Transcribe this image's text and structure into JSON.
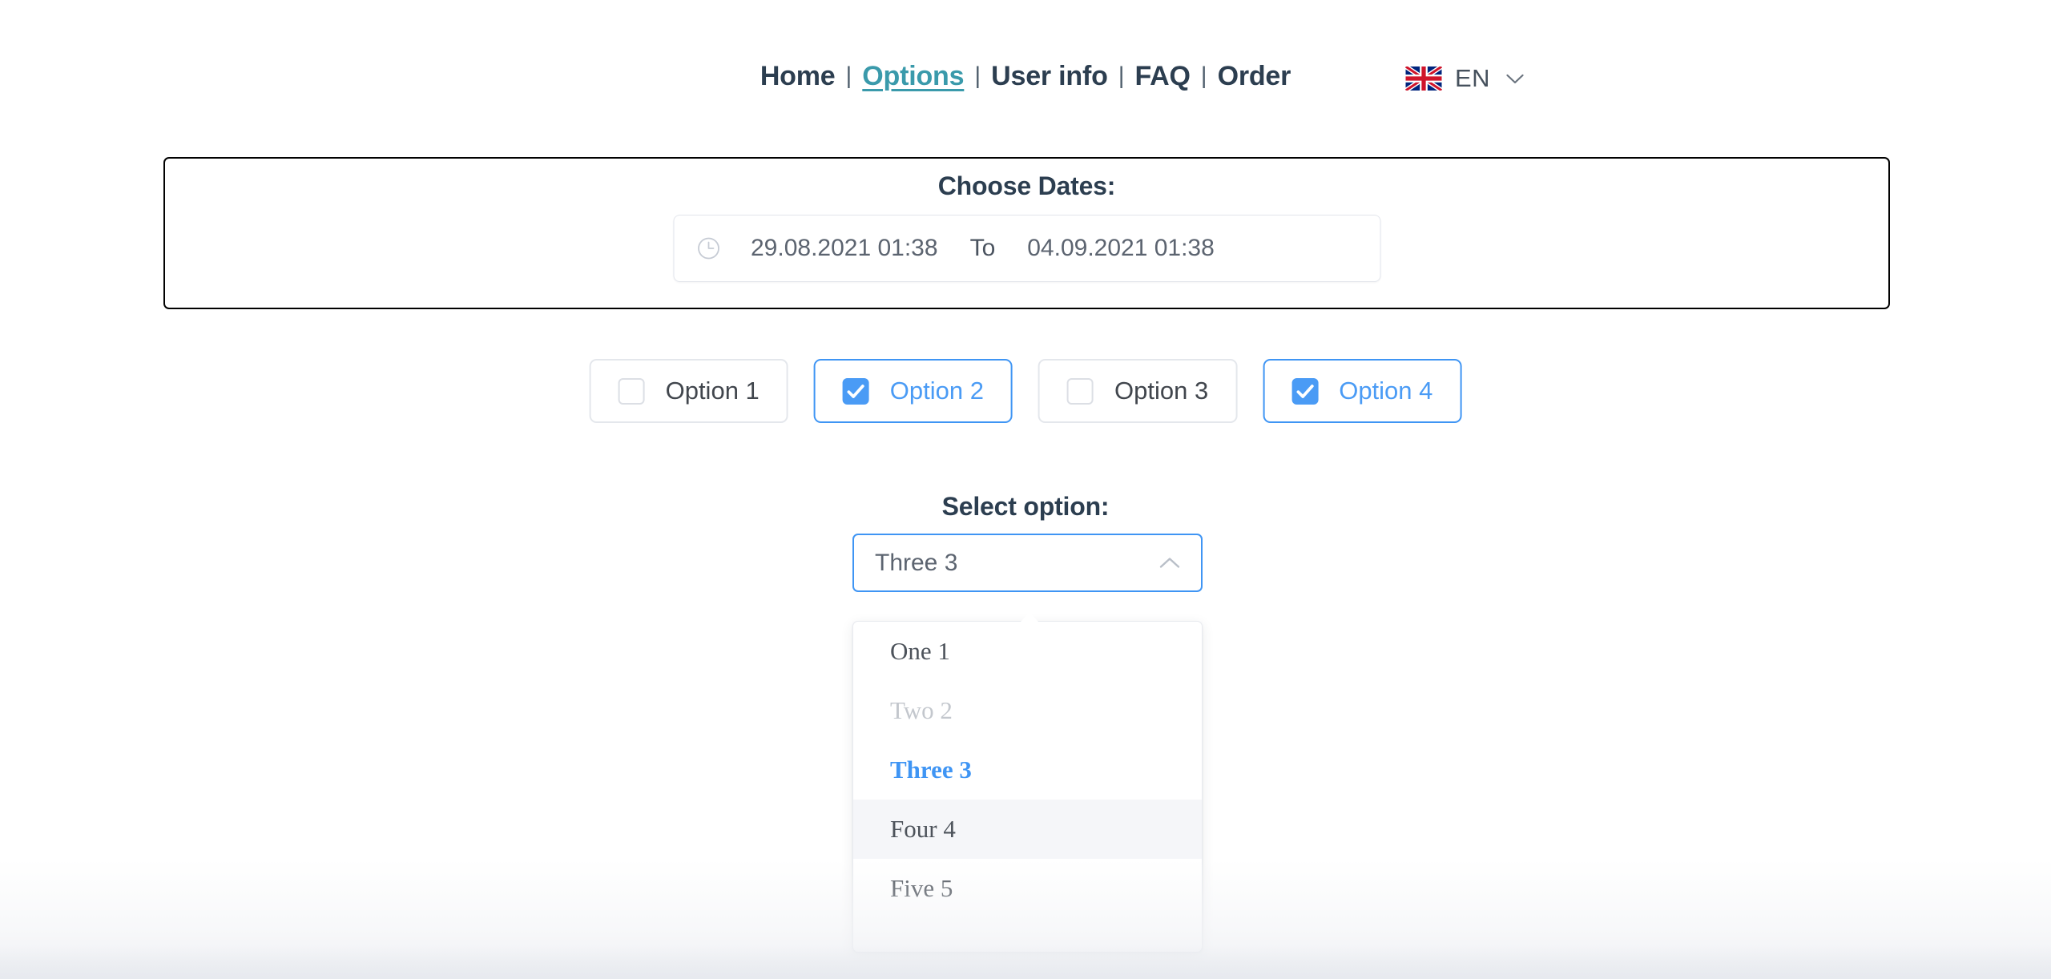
{
  "nav": {
    "separator": "|",
    "items": [
      {
        "label": "Home",
        "active": false
      },
      {
        "label": "Options",
        "active": true
      },
      {
        "label": "User info",
        "active": false
      },
      {
        "label": "FAQ",
        "active": false
      },
      {
        "label": "Order",
        "active": false
      }
    ]
  },
  "language": {
    "code": "EN",
    "flag": "uk-flag-icon",
    "chevron": "chevron-down-icon"
  },
  "dates": {
    "title": "Choose Dates:",
    "icon": "clock-icon",
    "from": "29.08.2021 01:38",
    "separator": "To",
    "to": "04.09.2021 01:38"
  },
  "options": {
    "items": [
      {
        "label": "Option 1",
        "checked": false
      },
      {
        "label": "Option 2",
        "checked": true
      },
      {
        "label": "Option 3",
        "checked": false
      },
      {
        "label": "Option 4",
        "checked": true
      }
    ]
  },
  "select": {
    "title": "Select option:",
    "value": "Three 3",
    "chevron": "chevron-up-icon",
    "expanded": true,
    "options": [
      {
        "label": "One 1",
        "state": "normal"
      },
      {
        "label": "Two 2",
        "state": "disabled"
      },
      {
        "label": "Three 3",
        "state": "selected"
      },
      {
        "label": "Four 4",
        "state": "hovered"
      },
      {
        "label": "Five 5",
        "state": "normal"
      }
    ]
  },
  "colors": {
    "accent_blue": "#3f95f4",
    "link_teal": "#3a9aab",
    "heading": "#2c3e50",
    "text": "#4d535b",
    "muted": "#c3c7cd",
    "border_light": "#e4e7ec"
  }
}
